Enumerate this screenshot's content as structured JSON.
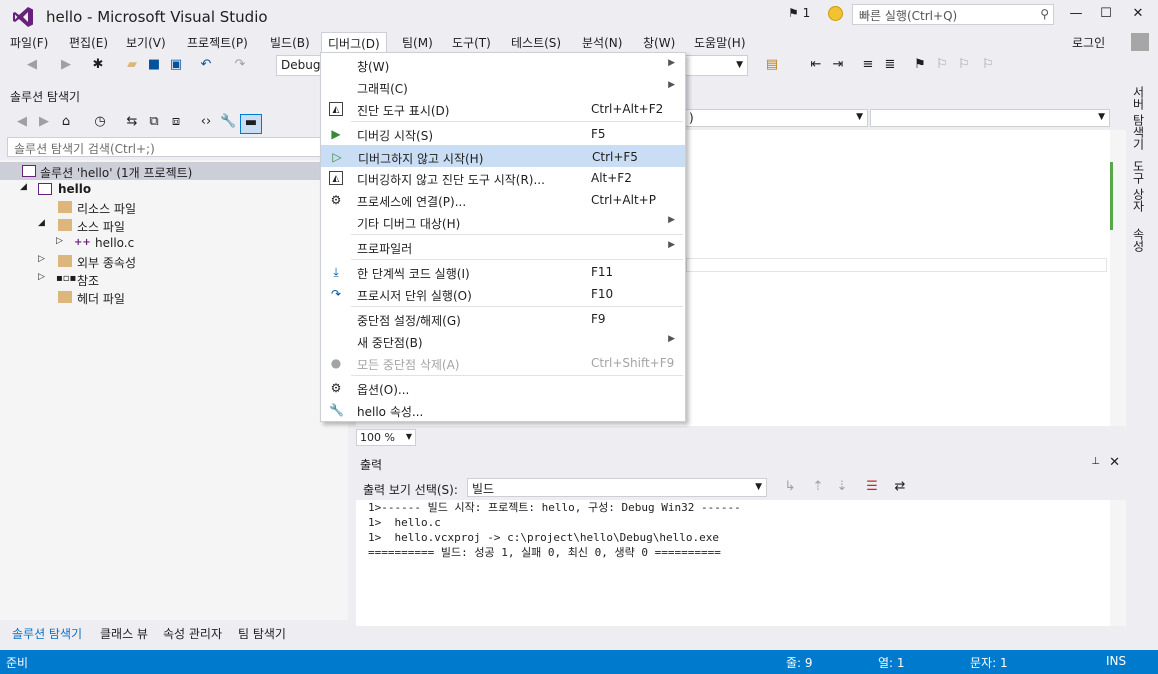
{
  "window": {
    "title": "hello - Microsoft Visual Studio",
    "notifications": "1",
    "quick_launch_placeholder": "빠른 실행(Ctrl+Q)"
  },
  "menubar": [
    "파일(F)",
    "편집(E)",
    "보기(V)",
    "프로젝트(P)",
    "빌드(B)",
    "디버그(D)",
    "팀(M)",
    "도구(T)",
    "테스트(S)",
    "분석(N)",
    "창(W)",
    "도움말(H)"
  ],
  "login": "로그인",
  "toolbar": {
    "config": "Debug"
  },
  "solution_explorer": {
    "title": "솔루션 탐색기",
    "search_placeholder": "솔루션 탐색기 검색(Ctrl+;)",
    "tree": {
      "solution": "솔루션 'hello' (1개 프로젝트)",
      "project": "hello",
      "resource": "리소스 파일",
      "source": "소스 파일",
      "file": "hello.c",
      "external": "외부 종속성",
      "references": "참조",
      "header": "헤더 파일"
    },
    "tabs": [
      "솔루션 탐색기",
      "클래스 뷰",
      "속성 관리자",
      "팀 탐색기"
    ]
  },
  "editor": {
    "nav_combo": ")",
    "zoom": "100 %"
  },
  "output": {
    "title": "출력",
    "source_label": "출력 보기 선택(S):",
    "source_value": "빌드",
    "lines": [
      "1>------ 빌드 시작: 프로젝트: hello, 구성: Debug Win32 ------",
      "1>  hello.c",
      "1>  hello.vcxproj -> c:\\project\\hello\\Debug\\hello.exe",
      "========== 빌드: 성공 1, 실패 0, 최신 0, 생략 0 =========="
    ]
  },
  "side_tabs": [
    "서버 탐색기",
    "도구 상자",
    "속성"
  ],
  "statusbar": {
    "ready": "준비",
    "line": "줄: 9",
    "col": "열: 1",
    "char": "문자: 1",
    "mode": "INS"
  },
  "debug_menu": {
    "window": "창(W)",
    "graphics": "그래픽(C)",
    "show_diag": "진단 도구 표시(D)",
    "show_diag_sc": "Ctrl+Alt+F2",
    "start": "디버깅 시작(S)",
    "start_sc": "F5",
    "start_nodebug": "디버그하지 않고 시작(H)",
    "start_nodebug_sc": "Ctrl+F5",
    "start_diag": "디버깅하지 않고 진단 도구 시작(R)...",
    "start_diag_sc": "Alt+F2",
    "attach": "프로세스에 연결(P)...",
    "attach_sc": "Ctrl+Alt+P",
    "other_targets": "기타 디버그 대상(H)",
    "profiler": "프로파일러",
    "step_into": "한 단계씩 코드 실행(I)",
    "step_into_sc": "F11",
    "step_over": "프로시저 단위 실행(O)",
    "step_over_sc": "F10",
    "toggle_bp": "중단점 설정/해제(G)",
    "toggle_bp_sc": "F9",
    "new_bp": "새 중단점(B)",
    "delete_all_bp": "모든 중단점 삭제(A)",
    "delete_all_bp_sc": "Ctrl+Shift+F9",
    "options": "옵션(O)...",
    "properties": "hello 속성..."
  }
}
